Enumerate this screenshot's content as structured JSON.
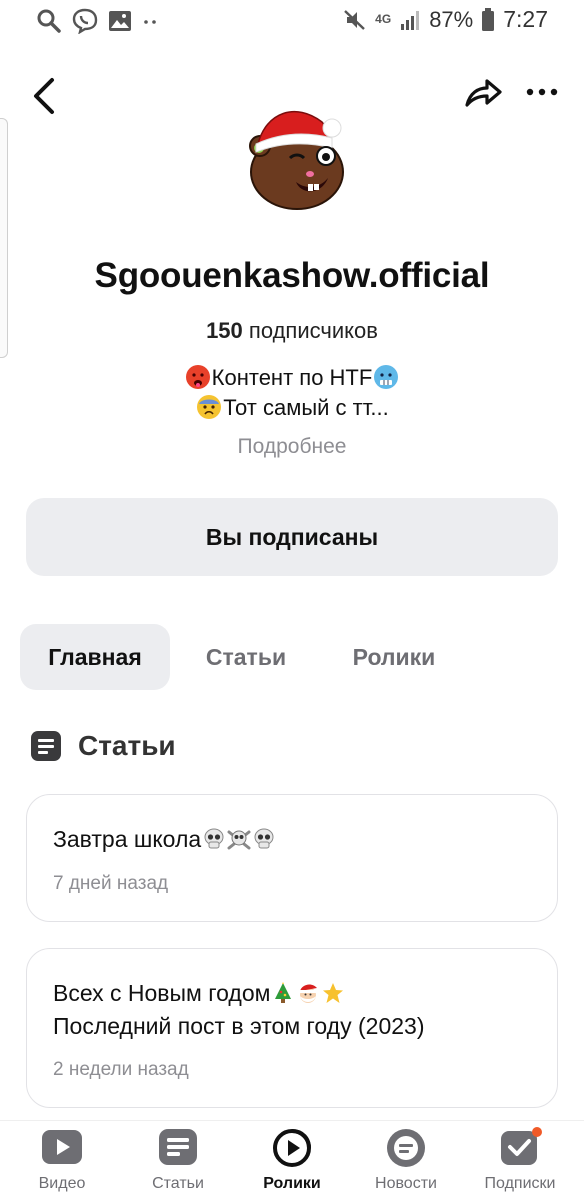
{
  "status_bar": {
    "battery": "87%",
    "time": "7:27",
    "network": "4G"
  },
  "channel": {
    "name": "Sgoouenkashow.official",
    "subs_count": "150",
    "subs_label": "подписчиков",
    "bio_line1": "Контент по HTF",
    "bio_line2": "Тот самый с тт...",
    "more": "Подробнее"
  },
  "subscribe_button": "Вы подписаны",
  "tabs": [
    {
      "label": "Главная",
      "active": true
    },
    {
      "label": "Статьи",
      "active": false
    },
    {
      "label": "Ролики",
      "active": false
    }
  ],
  "section": {
    "title": "Статьи"
  },
  "articles": [
    {
      "title": "Завтра школа",
      "time": "7 дней назад"
    },
    {
      "title_line1": "Всех с Новым годом",
      "title_line2": "Последний пост в этом году (2023)",
      "time": "2 недели назад"
    }
  ],
  "bottom_nav": [
    {
      "label": "Видео",
      "icon": "video-icon"
    },
    {
      "label": "Статьи",
      "icon": "articles-icon"
    },
    {
      "label": "Ролики",
      "icon": "clips-icon",
      "active": true
    },
    {
      "label": "Новости",
      "icon": "news-icon"
    },
    {
      "label": "Подписки",
      "icon": "subscriptions-icon",
      "badge": true
    }
  ],
  "colors": {
    "accent_badge": "#f05a28",
    "button_bg": "#ecedf0",
    "muted_text": "#8e8e93"
  }
}
